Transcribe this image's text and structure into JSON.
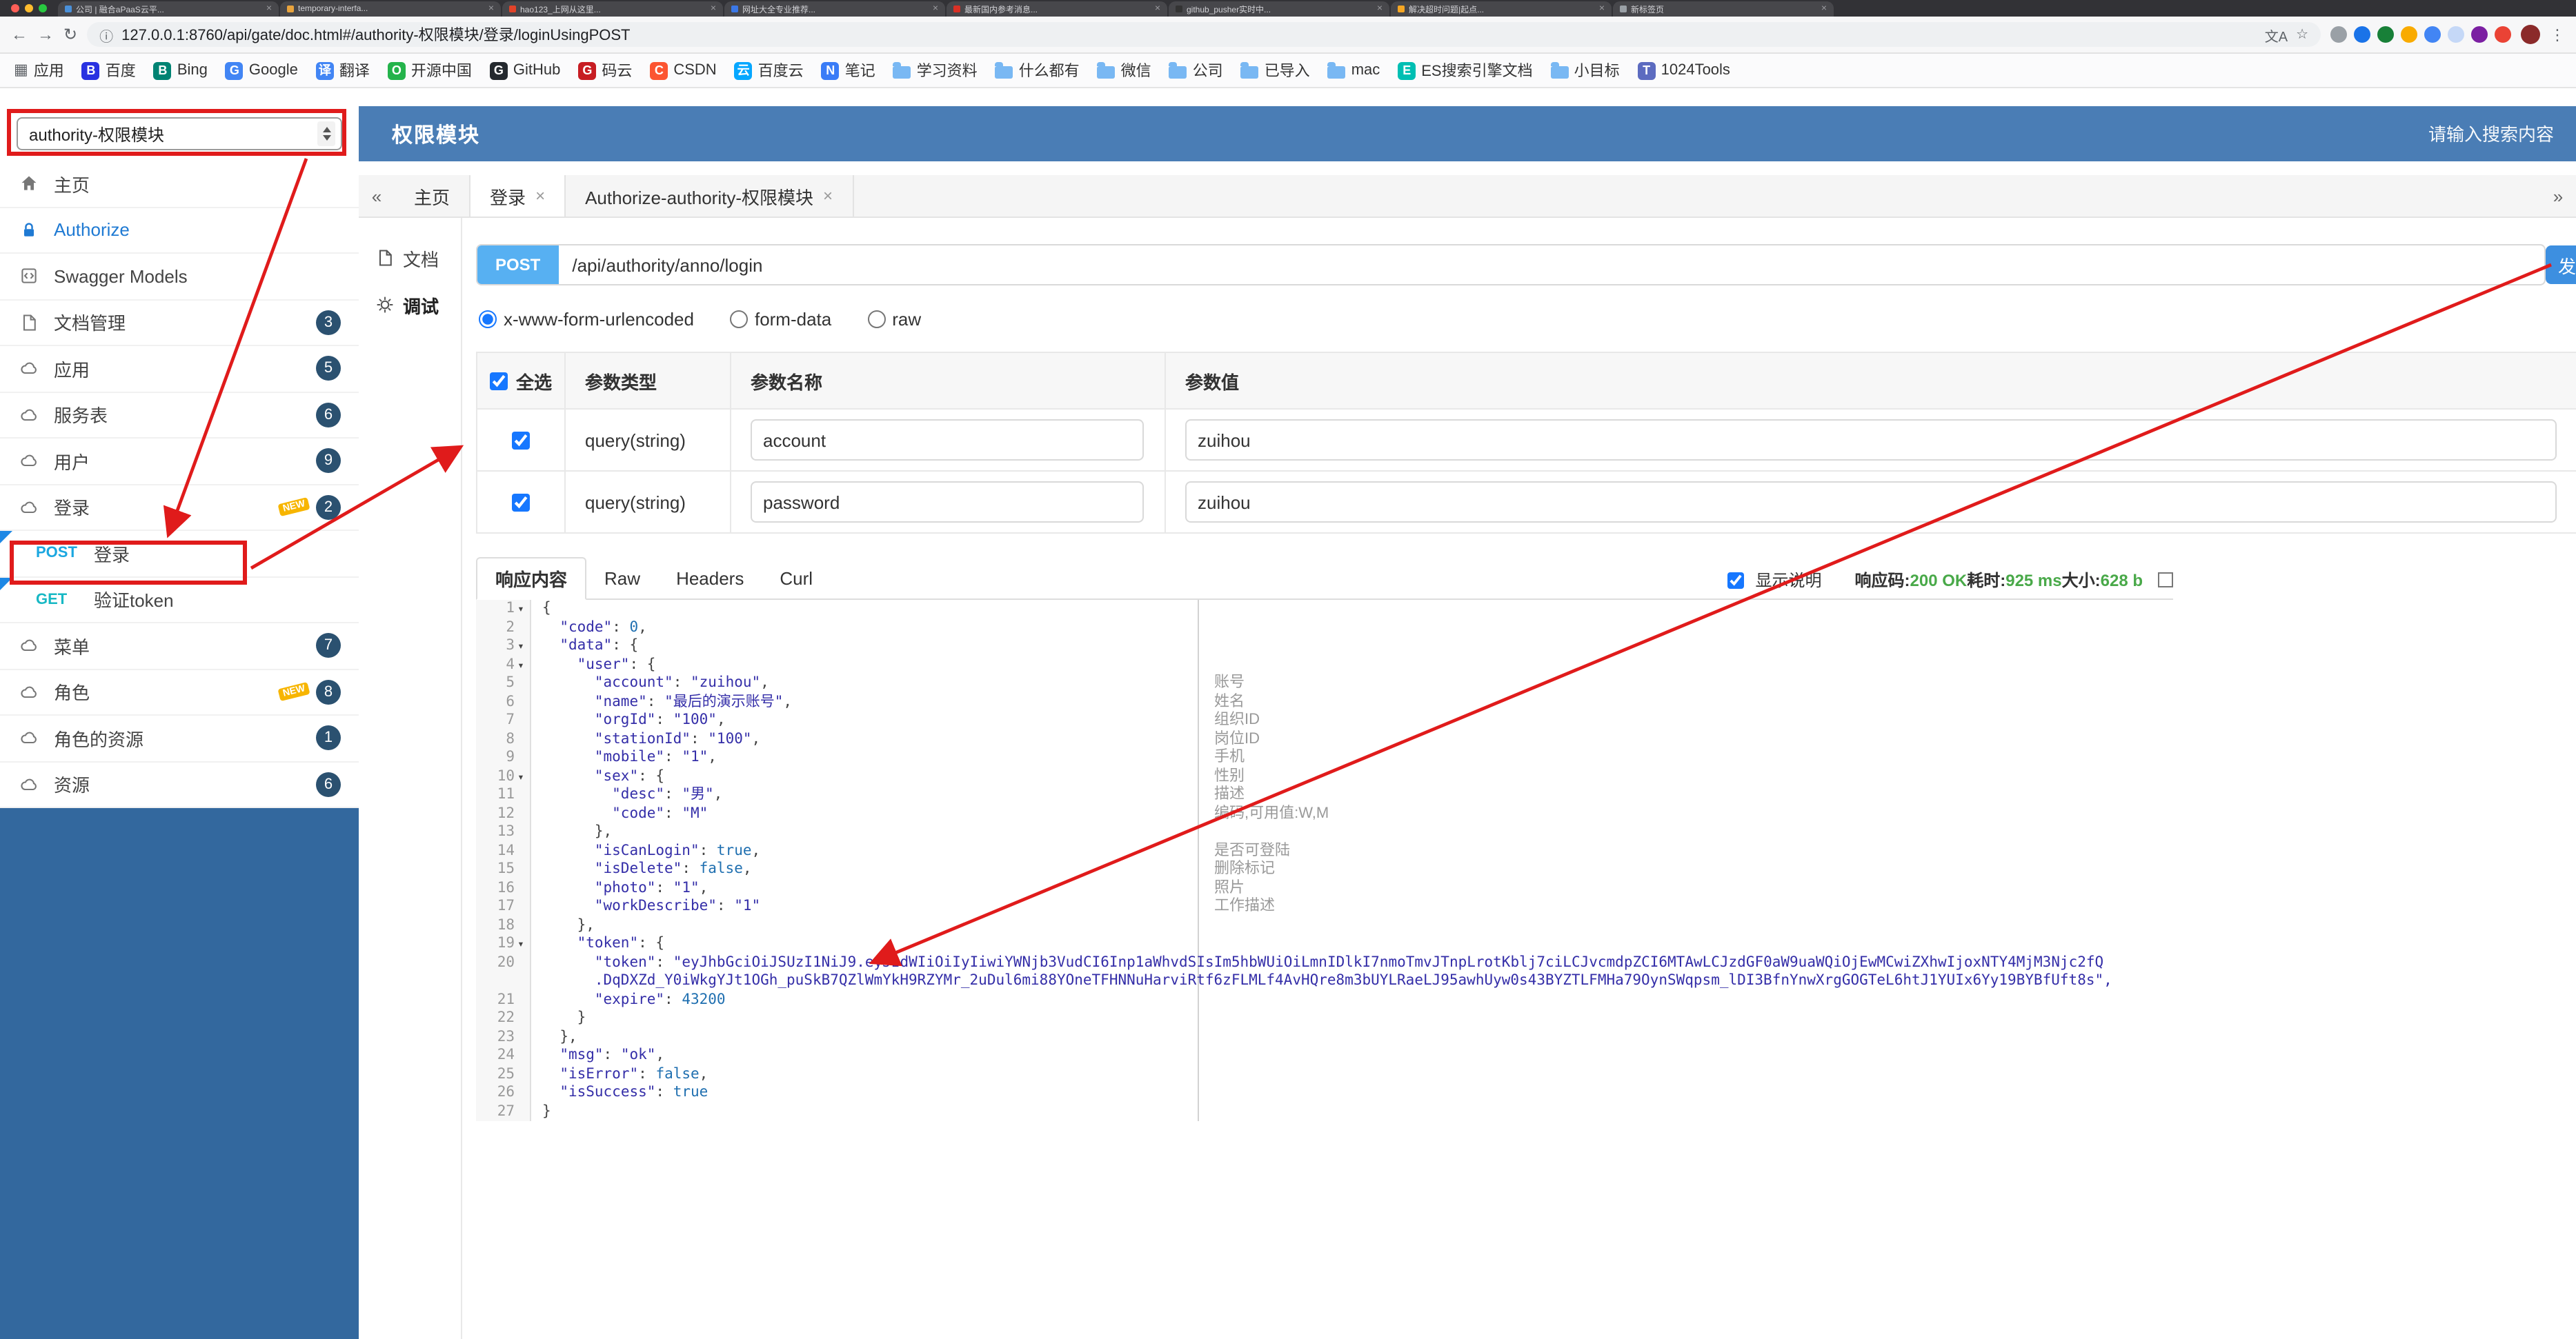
{
  "colors": {
    "header_blue": "#4a7db5",
    "sidebar_bottom": "#33689e",
    "post_chip": "#57b0f2",
    "method_post": "#1ba7e0",
    "method_get": "#17b8c4",
    "badge": "#2b5170",
    "annotation_red": "#e01b1b",
    "success_green": "#49a949",
    "link_blue": "#1f7ad3"
  },
  "browser": {
    "tabs": [
      {
        "title": "公司 | 融合aPaaS云平...",
        "color": "#4a90d9"
      },
      {
        "title": "temporary-interfa...",
        "color": "#e8a33d"
      },
      {
        "title": "hao123_上网从这里...",
        "color": "#e24329"
      },
      {
        "title": "网址大全专业推荐...",
        "color": "#3b78e7"
      },
      {
        "title": "最新国内参考消息...",
        "color": "#d93025"
      },
      {
        "title": "github_pusher实时中...",
        "color": "#333333"
      },
      {
        "title": "解决超时问题|起点...",
        "color": "#f5a623"
      },
      {
        "title": "新标签页",
        "color": "#9aa0a6"
      }
    ],
    "toolbar": {
      "url": "127.0.0.1:8760/api/gate/doc.html#/authority-权限模块/登录/loginUsingPOST",
      "ext_colors": [
        "#9aa0a6",
        "#1a73e8",
        "#188038",
        "#f9ab00",
        "#4285f4",
        "#c5d8f7",
        "#7b1fa2",
        "#ea4335"
      ]
    },
    "bookmarks": [
      {
        "label": "应用",
        "icon": "apps-grid",
        "glyph": "▦"
      },
      {
        "label": "百度",
        "icon": "site",
        "glyph": "B",
        "color": "#2932e1"
      },
      {
        "label": "Bing",
        "icon": "site",
        "glyph": "B",
        "color": "#008373"
      },
      {
        "label": "Google",
        "icon": "site",
        "glyph": "G",
        "color": "#4285f4"
      },
      {
        "label": "翻译",
        "icon": "site",
        "glyph": "译",
        "color": "#4285f4"
      },
      {
        "label": "开源中国",
        "icon": "site",
        "glyph": "O",
        "color": "#24b34b"
      },
      {
        "label": "GitHub",
        "icon": "site",
        "glyph": "G",
        "color": "#24292e"
      },
      {
        "label": "码云",
        "icon": "site",
        "glyph": "G",
        "color": "#c71d23"
      },
      {
        "label": "CSDN",
        "icon": "site",
        "glyph": "C",
        "color": "#fc5531"
      },
      {
        "label": "百度云",
        "icon": "site",
        "glyph": "云",
        "color": "#06a7ff"
      },
      {
        "label": "笔记",
        "icon": "site",
        "glyph": "N",
        "color": "#3a7cf7"
      },
      {
        "label": "学习资料",
        "icon": "folder"
      },
      {
        "label": "什么都有",
        "icon": "folder"
      },
      {
        "label": "微信",
        "icon": "folder"
      },
      {
        "label": "公司",
        "icon": "folder"
      },
      {
        "label": "已导入",
        "icon": "folder"
      },
      {
        "label": "mac",
        "icon": "folder"
      },
      {
        "label": "ES搜索引擎文档",
        "icon": "site",
        "glyph": "E",
        "color": "#00bfb3"
      },
      {
        "label": "小目标",
        "icon": "folder"
      },
      {
        "label": "1024Tools",
        "icon": "site",
        "glyph": "T",
        "color": "#5c6bc0"
      }
    ]
  },
  "header": {
    "module_select": "authority-权限模块",
    "title": "权限模块",
    "search_placeholder": "请输入搜索内容"
  },
  "sidebar": {
    "new_label": "NEW",
    "items": [
      {
        "icon": "home",
        "label": "主页"
      },
      {
        "icon": "lock",
        "label": "Authorize",
        "accent": true
      },
      {
        "icon": "models",
        "label": "Swagger Models"
      },
      {
        "icon": "doc",
        "label": "文档管理",
        "badge": "3"
      },
      {
        "icon": "cloud",
        "label": "应用",
        "badge": "5"
      },
      {
        "icon": "cloud",
        "label": "服务表",
        "badge": "6"
      },
      {
        "icon": "cloud",
        "label": "用户",
        "badge": "9"
      },
      {
        "icon": "cloud",
        "label": "登录",
        "badge": "2",
        "isNew": true
      },
      {
        "method": "POST",
        "label": "登录",
        "marked": true
      },
      {
        "method": "GET",
        "label": "验证token",
        "marked": true
      },
      {
        "icon": "cloud",
        "label": "菜单",
        "badge": "7"
      },
      {
        "icon": "cloud",
        "label": "角色",
        "badge": "8",
        "isNew": true
      },
      {
        "icon": "cloud",
        "label": "角色的资源",
        "badge": "1"
      },
      {
        "icon": "cloud",
        "label": "资源",
        "badge": "6"
      }
    ]
  },
  "doc_tabs": [
    {
      "label": "主页",
      "closable": false
    },
    {
      "label": "登录",
      "closable": true,
      "active": true
    },
    {
      "label": "Authorize-authority-权限模块",
      "closable": true
    }
  ],
  "subnav": [
    {
      "label": "文档",
      "icon": "doc"
    },
    {
      "label": "调试",
      "icon": "debug",
      "active": true
    }
  ],
  "endpoint": {
    "method": "POST",
    "path": "/api/authority/anno/login",
    "send_label": "发"
  },
  "body_types": [
    {
      "label": "x-www-form-urlencoded",
      "selected": true
    },
    {
      "label": "form-data",
      "selected": false
    },
    {
      "label": "raw",
      "selected": false
    }
  ],
  "params_table": {
    "headers": [
      "全选",
      "参数类型",
      "参数名称",
      "参数值"
    ],
    "rows": [
      {
        "checked": true,
        "type": "query(string)",
        "name": "account",
        "value": "zuihou"
      },
      {
        "checked": true,
        "type": "query(string)",
        "name": "password",
        "value": "zuihou"
      }
    ]
  },
  "response": {
    "tabs": [
      {
        "label": "响应内容",
        "active": true
      },
      {
        "label": "Raw"
      },
      {
        "label": "Headers"
      },
      {
        "label": "Curl"
      }
    ],
    "show_desc": "显示说明",
    "meta": [
      {
        "label": "响应码:",
        "value": "200 OK"
      },
      {
        "label": "耗时:",
        "value": "925 ms"
      },
      {
        "label": "大小:",
        "value": "628 b"
      }
    ]
  },
  "code": {
    "lines": [
      {
        "n": 1,
        "t": "{",
        "fold": true
      },
      {
        "n": 2,
        "t": "  \"code\": 0,"
      },
      {
        "n": 3,
        "t": "  \"data\": {",
        "fold": true
      },
      {
        "n": 4,
        "t": "    \"user\": {",
        "fold": true
      },
      {
        "n": 5,
        "t": "      \"account\": \"zuihou\",",
        "anno": "账号"
      },
      {
        "n": 6,
        "t": "      \"name\": \"最后的演示账号\",",
        "anno": "姓名"
      },
      {
        "n": 7,
        "t": "      \"orgId\": \"100\",",
        "anno": "组织ID"
      },
      {
        "n": 8,
        "t": "      \"stationId\": \"100\",",
        "anno": "岗位ID"
      },
      {
        "n": 9,
        "t": "      \"mobile\": \"1\",",
        "anno": "手机"
      },
      {
        "n": 10,
        "t": "      \"sex\": {",
        "fold": true,
        "anno": "性别"
      },
      {
        "n": 11,
        "t": "        \"desc\": \"男\",",
        "anno": "描述"
      },
      {
        "n": 12,
        "t": "        \"code\": \"M\"",
        "anno": "编码,可用值:W,M"
      },
      {
        "n": 13,
        "t": "      },"
      },
      {
        "n": 14,
        "t": "      \"isCanLogin\": true,",
        "anno": "是否可登陆"
      },
      {
        "n": 15,
        "t": "      \"isDelete\": false,",
        "anno": "删除标记"
      },
      {
        "n": 16,
        "t": "      \"photo\": \"1\",",
        "anno": "照片"
      },
      {
        "n": 17,
        "t": "      \"workDescribe\": \"1\"",
        "anno": "工作描述"
      },
      {
        "n": 18,
        "t": "    },"
      },
      {
        "n": 19,
        "t": "    \"token\": {",
        "fold": true
      },
      {
        "n": 20,
        "t": "      \"token\": \"eyJhbGciOiJSUzI1NiJ9.eyJzdWIiOiIyIiwiYWNjb3VudCI6Inp1aWhvdSIsIm5hbWUiOiLmnIDlkI7nmoTmvJTnpLrotKblj7ciLCJvcmdpZCI6MTAwLCJzdGF0aW9uaWQiOjEwMCwiZXhwIjoxNTY4MjM3Njc2fQ"
      },
      {
        "n": null,
        "t": "      .DqDXZd_Y0iWkgYJt1OGh_puSkB7QZlWmYkH9RZYMr_2uDul6mi88YOneTFHNNuHarviRtf6zFLMLf4AvHQre8m3bUYLRaeLJ95awhUyw0s43BYZTLFMHa79OynSWqpsm_lDI3BfnYnwXrgGOGTeL6htJ1YUIx6Yy19BYBfUft8s\",",
        "cont": true
      },
      {
        "n": 21,
        "t": "      \"expire\": 43200"
      },
      {
        "n": 22,
        "t": "    }"
      },
      {
        "n": 23,
        "t": "  },"
      },
      {
        "n": 24,
        "t": "  \"msg\": \"ok\","
      },
      {
        "n": 25,
        "t": "  \"isError\": false,"
      },
      {
        "n": 26,
        "t": "  \"isSuccess\": true"
      },
      {
        "n": 27,
        "t": "}"
      }
    ]
  }
}
